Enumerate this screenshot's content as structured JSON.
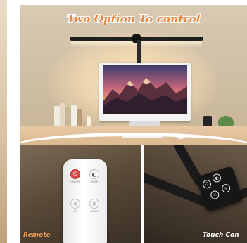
{
  "headline": "Two Option To control",
  "captions": {
    "remote": "Remote",
    "touch": "Touch Con"
  },
  "remote_buttons": [
    {
      "icon": "power-icon",
      "glyph": "⏻",
      "label": "ON/OFF"
    },
    {
      "icon": "mode-icon",
      "glyph": "◐",
      "label": "MODE"
    },
    {
      "icon": "brightness-up-icon",
      "glyph": "☼",
      "label": "UP"
    },
    {
      "icon": "brightness-down-icon",
      "glyph": "☼",
      "label": "DOWN"
    }
  ],
  "touch_buttons": [
    {
      "icon": "touch-power-icon",
      "glyph": "⏻"
    },
    {
      "icon": "touch-mode-icon",
      "glyph": "◐"
    },
    {
      "icon": "touch-up-icon",
      "glyph": "☼"
    },
    {
      "icon": "touch-down-icon",
      "glyph": "☼"
    }
  ],
  "colors": {
    "headline": "#e8833a",
    "power_button": "#d64a4a",
    "lamp": "#1f1f1f"
  }
}
